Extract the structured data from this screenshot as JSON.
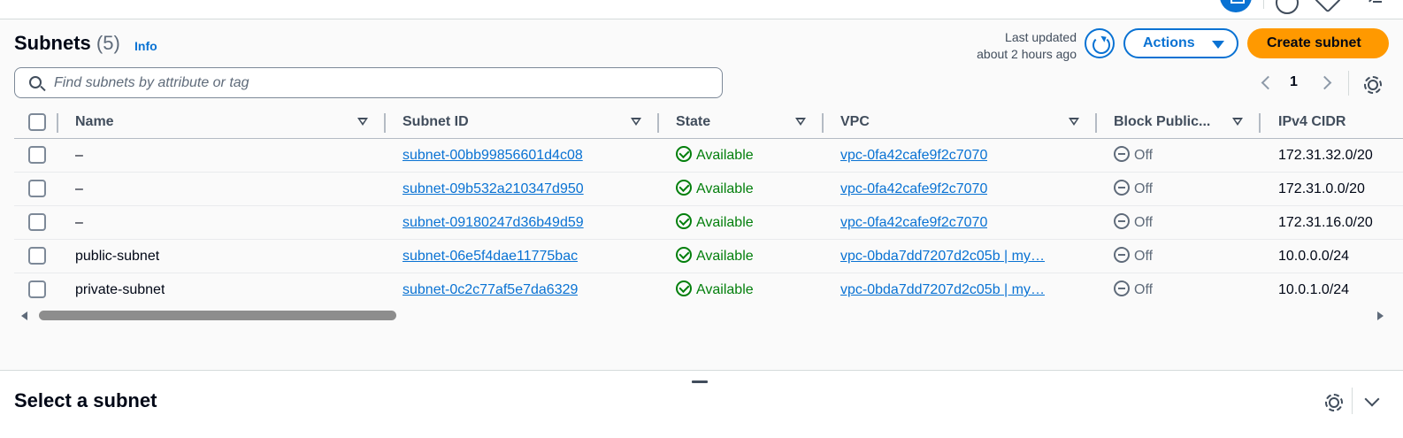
{
  "header": {
    "title": "Subnets",
    "count": "(5)",
    "info_label": "Info",
    "last_updated_line1": "Last updated",
    "last_updated_line2": "about 2 hours ago",
    "actions_label": "Actions",
    "create_label": "Create subnet"
  },
  "search": {
    "placeholder": "Find subnets by attribute or tag",
    "value": ""
  },
  "pagination": {
    "current_page": "1"
  },
  "table": {
    "columns": [
      "Name",
      "Subnet ID",
      "State",
      "VPC",
      "Block Public...",
      "IPv4 CIDR"
    ],
    "rows": [
      {
        "name": "–",
        "subnet_id": "subnet-00bb99856601d4c08",
        "state": "Available",
        "vpc": "vpc-0fa42cafe9f2c7070",
        "block_public": "Off",
        "ipv4_cidr": "172.31.32.0/20"
      },
      {
        "name": "–",
        "subnet_id": "subnet-09b532a210347d950",
        "state": "Available",
        "vpc": "vpc-0fa42cafe9f2c7070",
        "block_public": "Off",
        "ipv4_cidr": "172.31.0.0/20"
      },
      {
        "name": "–",
        "subnet_id": "subnet-09180247d36b49d59",
        "state": "Available",
        "vpc": "vpc-0fa42cafe9f2c7070",
        "block_public": "Off",
        "ipv4_cidr": "172.31.16.0/20"
      },
      {
        "name": "public-subnet",
        "subnet_id": "subnet-06e5f4dae11775bac",
        "state": "Available",
        "vpc": "vpc-0bda7dd7207d2c05b | my…",
        "block_public": "Off",
        "ipv4_cidr": "10.0.0.0/24"
      },
      {
        "name": "private-subnet",
        "subnet_id": "subnet-0c2c77af5e7da6329",
        "state": "Available",
        "vpc": "vpc-0bda7dd7207d2c05b | my…",
        "block_public": "Off",
        "ipv4_cidr": "10.0.1.0/24"
      }
    ]
  },
  "detail_panel": {
    "title": "Select a subnet"
  },
  "colors": {
    "link": "#0972d3",
    "primary_button": "#ff9900",
    "available": "#037f0c"
  },
  "icons": [
    "search-icon",
    "refresh-icon",
    "caret-down-icon",
    "chevron-left-icon",
    "chevron-right-icon",
    "gear-icon",
    "check-circle-icon",
    "minus-circle-icon",
    "chevron-down-icon"
  ]
}
